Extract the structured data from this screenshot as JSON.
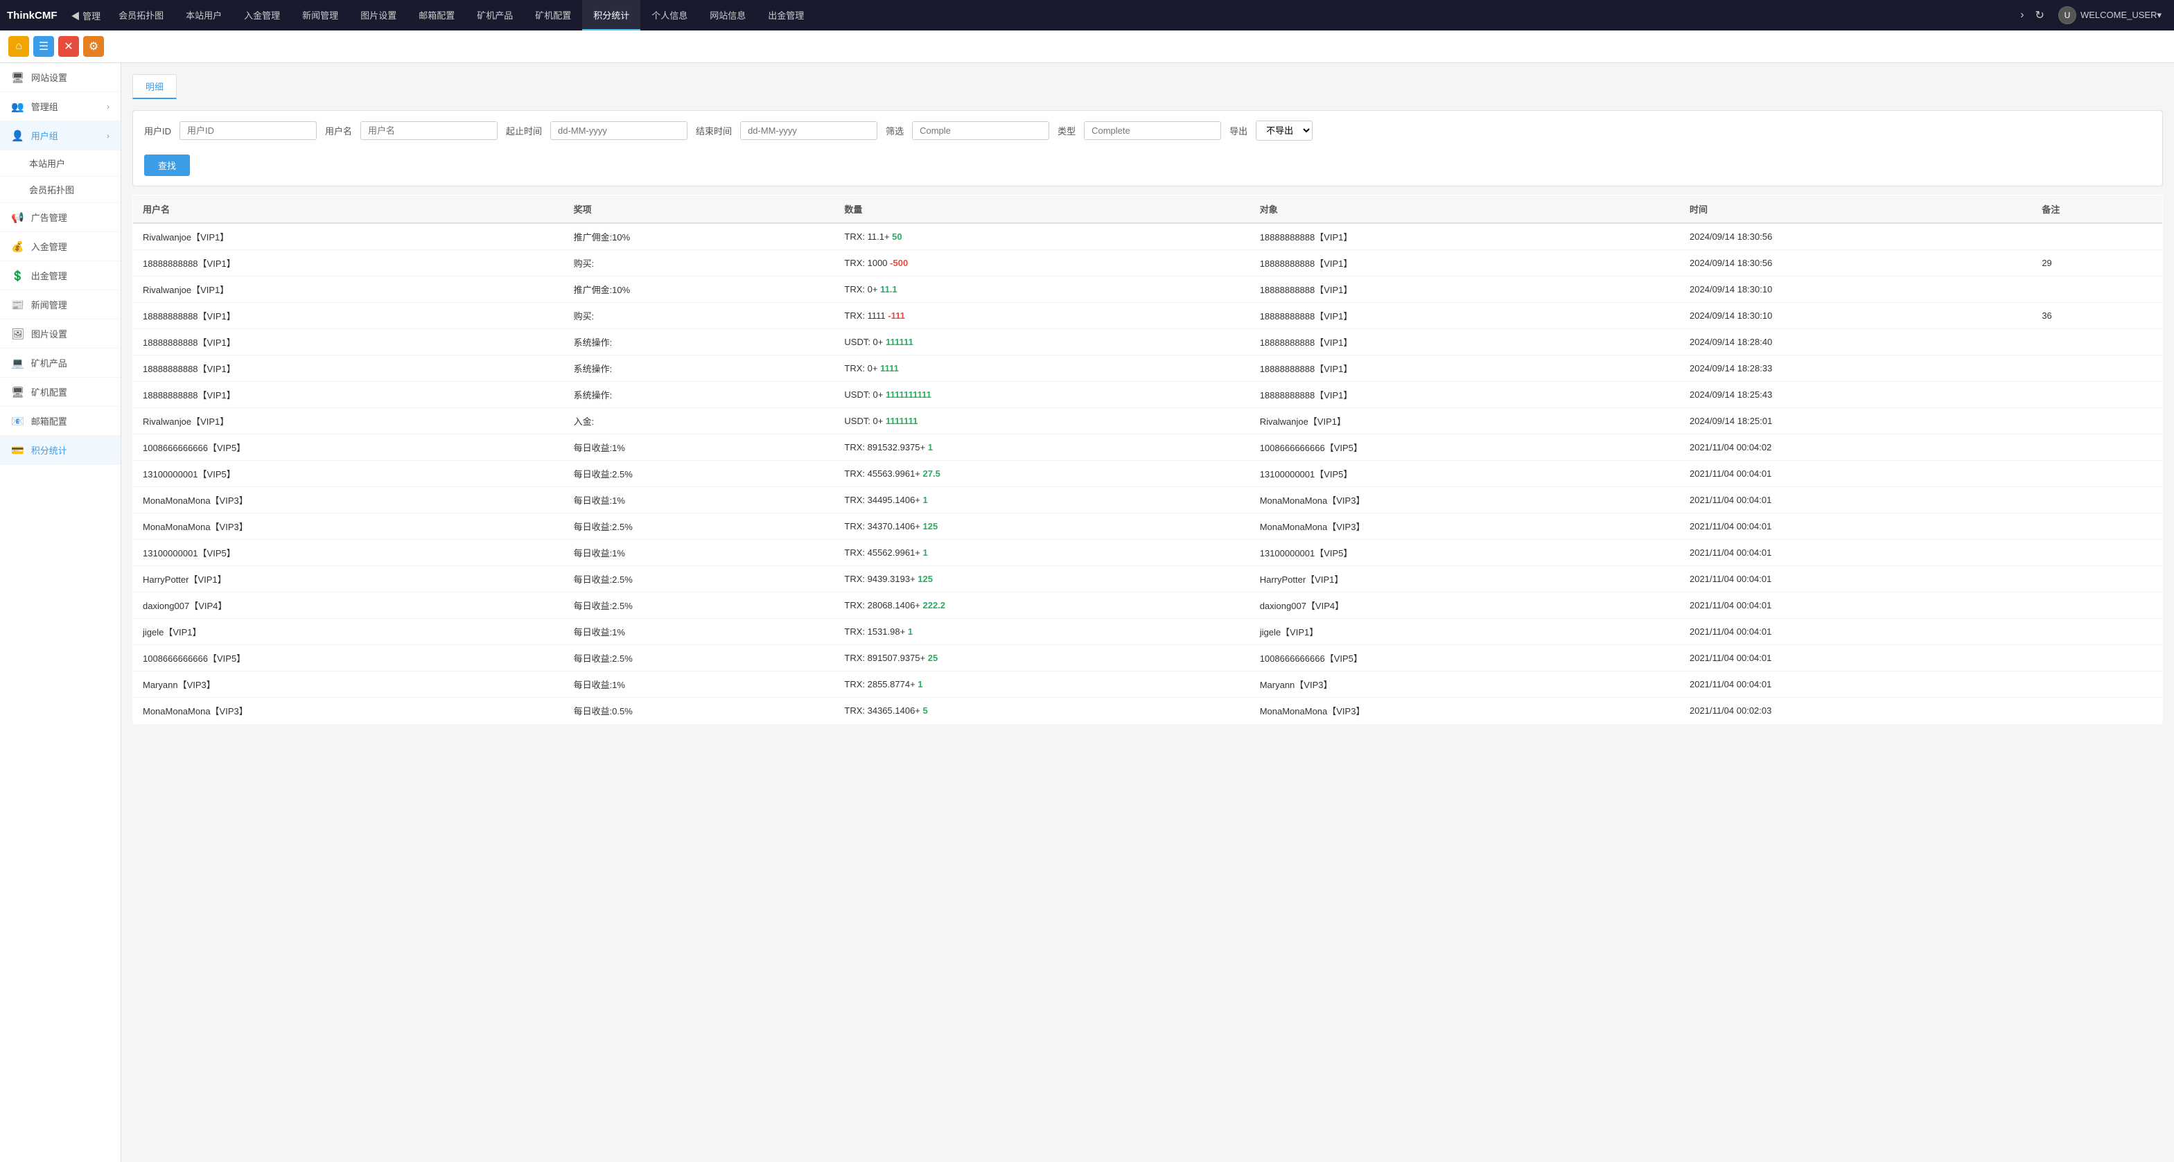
{
  "brand": "ThinkCMF",
  "nav": {
    "back_label": "◀ 管理",
    "items": [
      {
        "label": "会员拓扑图",
        "active": false
      },
      {
        "label": "本站用户",
        "active": false
      },
      {
        "label": "入金管理",
        "active": false
      },
      {
        "label": "新闻管理",
        "active": false
      },
      {
        "label": "图片设置",
        "active": false
      },
      {
        "label": "邮箱配置",
        "active": false
      },
      {
        "label": "矿机产品",
        "active": false
      },
      {
        "label": "矿机配置",
        "active": false
      },
      {
        "label": "积分统计",
        "active": true
      },
      {
        "label": "个人信息",
        "active": false
      },
      {
        "label": "网站信息",
        "active": false
      },
      {
        "label": "出金管理",
        "active": false
      }
    ],
    "more_label": "›",
    "refresh_label": "↻",
    "user_label": "WELCOME_USER▾"
  },
  "quick_bar": [
    {
      "icon": "⌂",
      "color": "home",
      "title": "主页"
    },
    {
      "icon": "☰",
      "color": "blue",
      "title": "菜单"
    },
    {
      "icon": "✕",
      "color": "red",
      "title": "关闭"
    },
    {
      "icon": "⚙",
      "color": "orange",
      "title": "设置"
    }
  ],
  "sidebar": {
    "items": [
      {
        "label": "网站设置",
        "icon": "🖥",
        "has_children": false,
        "active": false
      },
      {
        "label": "管理组",
        "icon": "👥",
        "has_children": true,
        "active": false
      },
      {
        "label": "用户组",
        "icon": "👤",
        "has_children": true,
        "active": true
      },
      {
        "label": "本站用户",
        "icon": "",
        "is_sub": true,
        "active": false
      },
      {
        "label": "会员拓扑图",
        "icon": "",
        "is_sub": true,
        "active": false
      },
      {
        "label": "广告管理",
        "icon": "📢",
        "has_children": false,
        "active": false
      },
      {
        "label": "入金管理",
        "icon": "💰",
        "has_children": false,
        "active": false
      },
      {
        "label": "出金管理",
        "icon": "💲",
        "has_children": false,
        "active": false
      },
      {
        "label": "新闻管理",
        "icon": "📰",
        "has_children": false,
        "active": false
      },
      {
        "label": "图片设置",
        "icon": "🖼",
        "has_children": false,
        "active": false
      },
      {
        "label": "矿机产品",
        "icon": "💻",
        "has_children": false,
        "active": false
      },
      {
        "label": "矿机配置",
        "icon": "🖥",
        "has_children": false,
        "active": false
      },
      {
        "label": "邮箱配置",
        "icon": "📧",
        "has_children": false,
        "active": false
      },
      {
        "label": "积分统计",
        "icon": "💳",
        "has_children": false,
        "active": true
      }
    ]
  },
  "tabs": [
    {
      "label": "明细",
      "active": true
    }
  ],
  "filter": {
    "userid_label": "用户ID",
    "userid_placeholder": "用户ID",
    "username_label": "用户名",
    "username_placeholder": "用户名",
    "start_time_label": "起止时间",
    "start_time_placeholder": "dd-MM-yyyy",
    "end_time_label": "结束时间",
    "end_time_placeholder": "dd-MM-yyyy",
    "filter_label": "筛选",
    "filter_placeholder": "Comple",
    "type_label": "类型",
    "type_placeholder": "Complete",
    "export_label": "导出",
    "export_default": "不导出",
    "search_btn": "查找"
  },
  "table": {
    "columns": [
      "用户名",
      "奖项",
      "数量",
      "对象",
      "时间",
      "备注"
    ],
    "rows": [
      {
        "username": "Rivalwanjoe【VIP1】",
        "award": "推广佣金:10%",
        "qty_base": "TRX: 11.1+",
        "qty_change": "50",
        "qty_type": "pos",
        "target": "18888888888【VIP1】",
        "time": "2024/09/14 18:30:56",
        "remark": ""
      },
      {
        "username": "18888888888【VIP1】",
        "award": "购买:",
        "qty_base": "TRX: 1000",
        "qty_change": "-500",
        "qty_type": "neg",
        "target": "18888888888【VIP1】",
        "time": "2024/09/14 18:30:56",
        "remark": "29"
      },
      {
        "username": "Rivalwanjoe【VIP1】",
        "award": "推广佣金:10%",
        "qty_base": "TRX: 0+",
        "qty_change": "11.1",
        "qty_type": "pos",
        "target": "18888888888【VIP1】",
        "time": "2024/09/14 18:30:10",
        "remark": ""
      },
      {
        "username": "18888888888【VIP1】",
        "award": "购买:",
        "qty_base": "TRX: 1111",
        "qty_change": "-111",
        "qty_type": "neg",
        "target": "18888888888【VIP1】",
        "time": "2024/09/14 18:30:10",
        "remark": "36"
      },
      {
        "username": "18888888888【VIP1】",
        "award": "系统操作:",
        "qty_base": "USDT: 0+",
        "qty_change": "111111",
        "qty_type": "pos",
        "target": "18888888888【VIP1】",
        "time": "2024/09/14 18:28:40",
        "remark": ""
      },
      {
        "username": "18888888888【VIP1】",
        "award": "系统操作:",
        "qty_base": "TRX: 0+",
        "qty_change": "1111",
        "qty_type": "pos",
        "target": "18888888888【VIP1】",
        "time": "2024/09/14 18:28:33",
        "remark": ""
      },
      {
        "username": "18888888888【VIP1】",
        "award": "系统操作:",
        "qty_base": "USDT: 0+",
        "qty_change": "1111111111",
        "qty_type": "pos",
        "target": "18888888888【VIP1】",
        "time": "2024/09/14 18:25:43",
        "remark": ""
      },
      {
        "username": "Rivalwanjoe【VIP1】",
        "award": "入金:",
        "qty_base": "USDT: 0+",
        "qty_change": "1111111",
        "qty_type": "pos",
        "target": "Rivalwanjoe【VIP1】",
        "time": "2024/09/14 18:25:01",
        "remark": ""
      },
      {
        "username": "1008666666666【VIP5】",
        "award": "每日收益:1%",
        "qty_base": "TRX: 891532.9375+",
        "qty_change": "1",
        "qty_type": "pos",
        "target": "1008666666666【VIP5】",
        "time": "2021/11/04 00:04:02",
        "remark": ""
      },
      {
        "username": "13100000001【VIP5】",
        "award": "每日收益:2.5%",
        "qty_base": "TRX: 45563.9961+",
        "qty_change": "27.5",
        "qty_type": "pos",
        "target": "13100000001【VIP5】",
        "time": "2021/11/04 00:04:01",
        "remark": ""
      },
      {
        "username": "MonaMonaMona【VIP3】",
        "award": "每日收益:1%",
        "qty_base": "TRX: 34495.1406+",
        "qty_change": "1",
        "qty_type": "pos",
        "target": "MonaMonaMona【VIP3】",
        "time": "2021/11/04 00:04:01",
        "remark": ""
      },
      {
        "username": "MonaMonaMona【VIP3】",
        "award": "每日收益:2.5%",
        "qty_base": "TRX: 34370.1406+",
        "qty_change": "125",
        "qty_type": "pos",
        "target": "MonaMonaMona【VIP3】",
        "time": "2021/11/04 00:04:01",
        "remark": ""
      },
      {
        "username": "13100000001【VIP5】",
        "award": "每日收益:1%",
        "qty_base": "TRX: 45562.9961+",
        "qty_change": "1",
        "qty_type": "pos",
        "target": "13100000001【VIP5】",
        "time": "2021/11/04 00:04:01",
        "remark": ""
      },
      {
        "username": "HarryPotter【VIP1】",
        "award": "每日收益:2.5%",
        "qty_base": "TRX: 9439.3193+",
        "qty_change": "125",
        "qty_type": "pos",
        "target": "HarryPotter【VIP1】",
        "time": "2021/11/04 00:04:01",
        "remark": ""
      },
      {
        "username": "daxiong007【VIP4】",
        "award": "每日收益:2.5%",
        "qty_base": "TRX: 28068.1406+",
        "qty_change": "222.2",
        "qty_type": "pos",
        "target": "daxiong007【VIP4】",
        "time": "2021/11/04 00:04:01",
        "remark": ""
      },
      {
        "username": "jigele【VIP1】",
        "award": "每日收益:1%",
        "qty_base": "TRX: 1531.98+",
        "qty_change": "1",
        "qty_type": "pos",
        "target": "jigele【VIP1】",
        "time": "2021/11/04 00:04:01",
        "remark": ""
      },
      {
        "username": "1008666666666【VIP5】",
        "award": "每日收益:2.5%",
        "qty_base": "TRX: 891507.9375+",
        "qty_change": "25",
        "qty_type": "pos",
        "target": "1008666666666【VIP5】",
        "time": "2021/11/04 00:04:01",
        "remark": ""
      },
      {
        "username": "Maryann【VIP3】",
        "award": "每日收益:1%",
        "qty_base": "TRX: 2855.8774+",
        "qty_change": "1",
        "qty_type": "pos",
        "target": "Maryann【VIP3】",
        "time": "2021/11/04 00:04:01",
        "remark": ""
      },
      {
        "username": "MonaMonaMona【VIP3】",
        "award": "每日收益:0.5%",
        "qty_base": "TRX: 34365.1406+",
        "qty_change": "5",
        "qty_type": "pos",
        "target": "MonaMonaMona【VIP3】",
        "time": "2021/11/04 00:02:03",
        "remark": ""
      }
    ]
  }
}
